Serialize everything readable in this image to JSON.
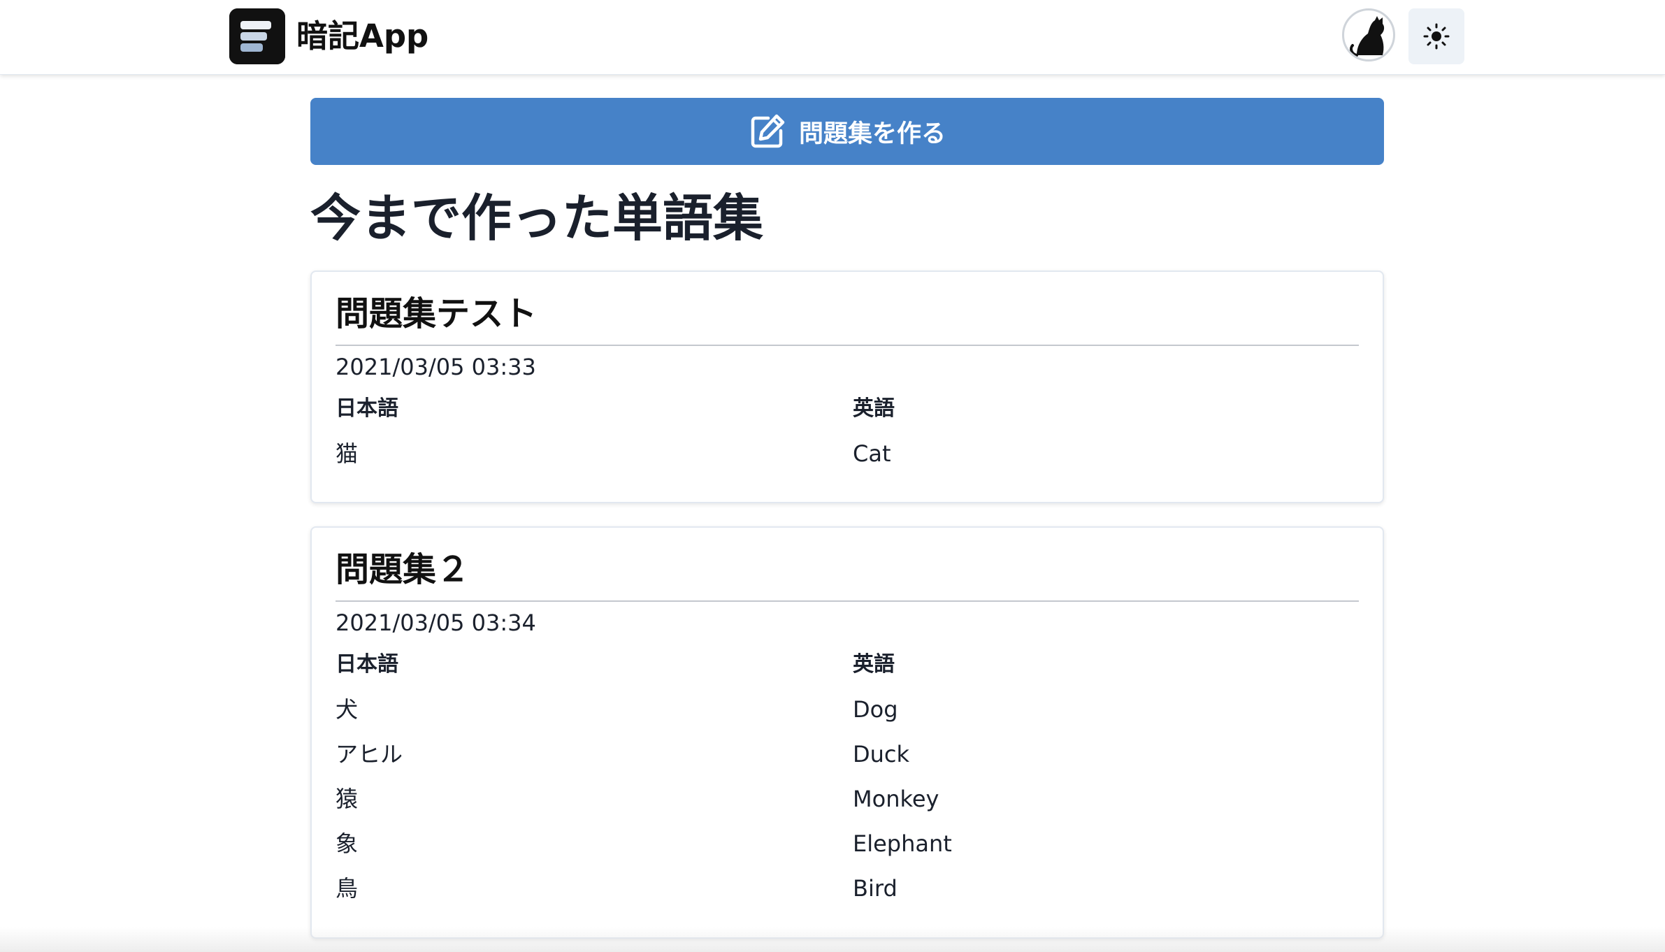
{
  "header": {
    "app_name": "暗記App",
    "logo_icon": "app-logo-icon",
    "avatar_icon": "cat-avatar-icon",
    "theme_icon": "sun-icon"
  },
  "actions": {
    "create_label": "問題集を作る",
    "create_icon": "edit-icon"
  },
  "page": {
    "title": "今まで作った単語集"
  },
  "colors": {
    "primary": "#4682c8",
    "header_bg": "#ffffff",
    "toggle_bg": "#edf2f7",
    "text": "#1a202c"
  },
  "sets": [
    {
      "title": "問題集テスト",
      "date": "2021/03/05 03:33",
      "col_japanese": "日本語",
      "col_english": "英語",
      "rows": [
        {
          "ja": "猫",
          "en": "Cat"
        }
      ]
    },
    {
      "title": "問題集２",
      "date": "2021/03/05 03:34",
      "col_japanese": "日本語",
      "col_english": "英語",
      "rows": [
        {
          "ja": "犬",
          "en": "Dog"
        },
        {
          "ja": "アヒル",
          "en": "Duck"
        },
        {
          "ja": "猿",
          "en": "Monkey"
        },
        {
          "ja": "象",
          "en": "Elephant"
        },
        {
          "ja": "鳥",
          "en": "Bird"
        }
      ]
    }
  ]
}
